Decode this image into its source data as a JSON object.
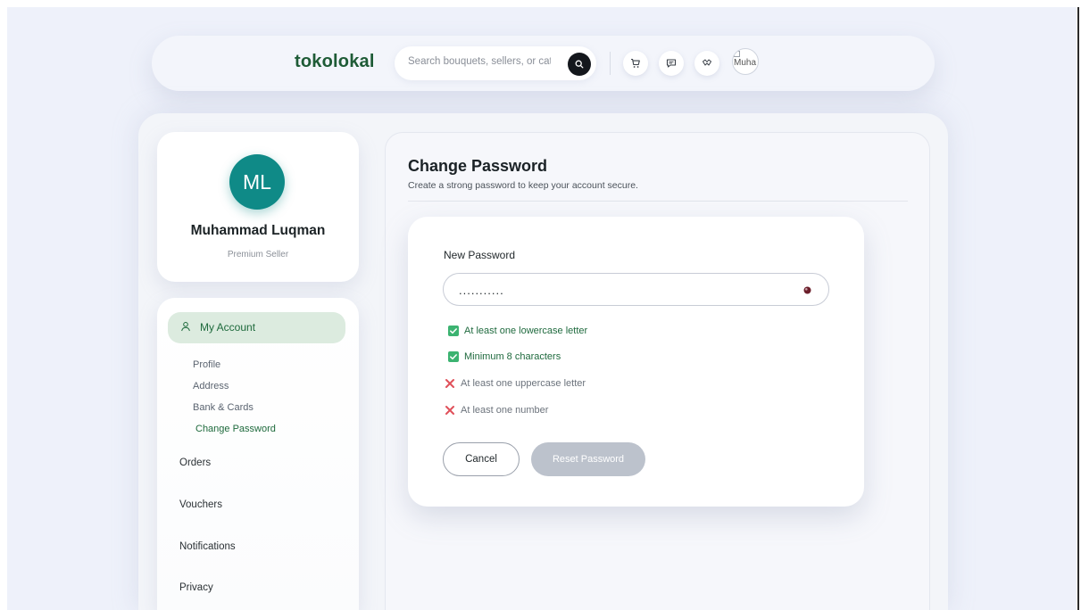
{
  "header": {
    "brand": "tokolokal",
    "search_placeholder": "Search bouquets, sellers, or categories",
    "avatar_alt": "Muha",
    "icons": [
      "cart-icon",
      "chat-icon",
      "compare-icon",
      "search-icon"
    ]
  },
  "profile": {
    "initials": "ML",
    "name": "Muhammad Luqman",
    "role": "Premium Seller"
  },
  "sidebar": {
    "active_section": "My Account",
    "sub_items": [
      "Profile",
      "Address",
      "Bank & Cards",
      "Change Password"
    ],
    "active_sub_item": "Change Password",
    "items": [
      "Orders",
      "Vouchers",
      "Notifications",
      "Privacy"
    ]
  },
  "main": {
    "title": "Change Password",
    "subtitle": "Create a strong password to keep your account secure.",
    "form": {
      "field_label": "New Password",
      "password_value": "...........",
      "rules": [
        {
          "text": "At least one lowercase letter",
          "met": true
        },
        {
          "text": "Minimum 8 characters",
          "met": true
        },
        {
          "text": "At least one uppercase letter",
          "met": false
        },
        {
          "text": "At least one number",
          "met": false
        }
      ],
      "cancel_label": "Cancel",
      "reset_label": "Reset Password"
    }
  },
  "colors": {
    "brand_green": "#1e5b36",
    "avatar_teal": "#0f8a87",
    "rule_ok": "#3cb371",
    "rule_bad": "#e0505a",
    "reset_disabled": "#bcc2cc"
  }
}
